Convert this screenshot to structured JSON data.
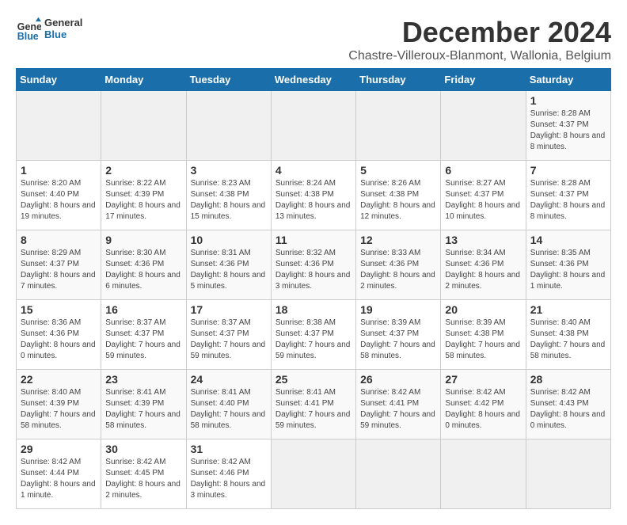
{
  "header": {
    "logo_general": "General",
    "logo_blue": "Blue",
    "title": "December 2024",
    "subtitle": "Chastre-Villeroux-Blanmont, Wallonia, Belgium"
  },
  "calendar": {
    "days_of_week": [
      "Sunday",
      "Monday",
      "Tuesday",
      "Wednesday",
      "Thursday",
      "Friday",
      "Saturday"
    ],
    "weeks": [
      [
        {
          "day": "",
          "empty": true
        },
        {
          "day": "",
          "empty": true
        },
        {
          "day": "",
          "empty": true
        },
        {
          "day": "",
          "empty": true
        },
        {
          "day": "",
          "empty": true
        },
        {
          "day": "",
          "empty": true
        },
        {
          "day": "1",
          "sunrise": "Sunrise: 8:28 AM",
          "sunset": "Sunset: 4:37 PM",
          "daylight": "Daylight: 8 hours and 8 minutes."
        }
      ],
      [
        {
          "day": "1",
          "sunrise": "Sunrise: 8:20 AM",
          "sunset": "Sunset: 4:40 PM",
          "daylight": "Daylight: 8 hours and 19 minutes."
        },
        {
          "day": "2",
          "sunrise": "Sunrise: 8:22 AM",
          "sunset": "Sunset: 4:39 PM",
          "daylight": "Daylight: 8 hours and 17 minutes."
        },
        {
          "day": "3",
          "sunrise": "Sunrise: 8:23 AM",
          "sunset": "Sunset: 4:38 PM",
          "daylight": "Daylight: 8 hours and 15 minutes."
        },
        {
          "day": "4",
          "sunrise": "Sunrise: 8:24 AM",
          "sunset": "Sunset: 4:38 PM",
          "daylight": "Daylight: 8 hours and 13 minutes."
        },
        {
          "day": "5",
          "sunrise": "Sunrise: 8:26 AM",
          "sunset": "Sunset: 4:38 PM",
          "daylight": "Daylight: 8 hours and 12 minutes."
        },
        {
          "day": "6",
          "sunrise": "Sunrise: 8:27 AM",
          "sunset": "Sunset: 4:37 PM",
          "daylight": "Daylight: 8 hours and 10 minutes."
        },
        {
          "day": "7",
          "sunrise": "Sunrise: 8:28 AM",
          "sunset": "Sunset: 4:37 PM",
          "daylight": "Daylight: 8 hours and 8 minutes."
        }
      ],
      [
        {
          "day": "8",
          "sunrise": "Sunrise: 8:29 AM",
          "sunset": "Sunset: 4:37 PM",
          "daylight": "Daylight: 8 hours and 7 minutes."
        },
        {
          "day": "9",
          "sunrise": "Sunrise: 8:30 AM",
          "sunset": "Sunset: 4:36 PM",
          "daylight": "Daylight: 8 hours and 6 minutes."
        },
        {
          "day": "10",
          "sunrise": "Sunrise: 8:31 AM",
          "sunset": "Sunset: 4:36 PM",
          "daylight": "Daylight: 8 hours and 5 minutes."
        },
        {
          "day": "11",
          "sunrise": "Sunrise: 8:32 AM",
          "sunset": "Sunset: 4:36 PM",
          "daylight": "Daylight: 8 hours and 3 minutes."
        },
        {
          "day": "12",
          "sunrise": "Sunrise: 8:33 AM",
          "sunset": "Sunset: 4:36 PM",
          "daylight": "Daylight: 8 hours and 2 minutes."
        },
        {
          "day": "13",
          "sunrise": "Sunrise: 8:34 AM",
          "sunset": "Sunset: 4:36 PM",
          "daylight": "Daylight: 8 hours and 2 minutes."
        },
        {
          "day": "14",
          "sunrise": "Sunrise: 8:35 AM",
          "sunset": "Sunset: 4:36 PM",
          "daylight": "Daylight: 8 hours and 1 minute."
        }
      ],
      [
        {
          "day": "15",
          "sunrise": "Sunrise: 8:36 AM",
          "sunset": "Sunset: 4:36 PM",
          "daylight": "Daylight: 8 hours and 0 minutes."
        },
        {
          "day": "16",
          "sunrise": "Sunrise: 8:37 AM",
          "sunset": "Sunset: 4:37 PM",
          "daylight": "Daylight: 7 hours and 59 minutes."
        },
        {
          "day": "17",
          "sunrise": "Sunrise: 8:37 AM",
          "sunset": "Sunset: 4:37 PM",
          "daylight": "Daylight: 7 hours and 59 minutes."
        },
        {
          "day": "18",
          "sunrise": "Sunrise: 8:38 AM",
          "sunset": "Sunset: 4:37 PM",
          "daylight": "Daylight: 7 hours and 59 minutes."
        },
        {
          "day": "19",
          "sunrise": "Sunrise: 8:39 AM",
          "sunset": "Sunset: 4:37 PM",
          "daylight": "Daylight: 7 hours and 58 minutes."
        },
        {
          "day": "20",
          "sunrise": "Sunrise: 8:39 AM",
          "sunset": "Sunset: 4:38 PM",
          "daylight": "Daylight: 7 hours and 58 minutes."
        },
        {
          "day": "21",
          "sunrise": "Sunrise: 8:40 AM",
          "sunset": "Sunset: 4:38 PM",
          "daylight": "Daylight: 7 hours and 58 minutes."
        }
      ],
      [
        {
          "day": "22",
          "sunrise": "Sunrise: 8:40 AM",
          "sunset": "Sunset: 4:39 PM",
          "daylight": "Daylight: 7 hours and 58 minutes."
        },
        {
          "day": "23",
          "sunrise": "Sunrise: 8:41 AM",
          "sunset": "Sunset: 4:39 PM",
          "daylight": "Daylight: 7 hours and 58 minutes."
        },
        {
          "day": "24",
          "sunrise": "Sunrise: 8:41 AM",
          "sunset": "Sunset: 4:40 PM",
          "daylight": "Daylight: 7 hours and 58 minutes."
        },
        {
          "day": "25",
          "sunrise": "Sunrise: 8:41 AM",
          "sunset": "Sunset: 4:41 PM",
          "daylight": "Daylight: 7 hours and 59 minutes."
        },
        {
          "day": "26",
          "sunrise": "Sunrise: 8:42 AM",
          "sunset": "Sunset: 4:41 PM",
          "daylight": "Daylight: 7 hours and 59 minutes."
        },
        {
          "day": "27",
          "sunrise": "Sunrise: 8:42 AM",
          "sunset": "Sunset: 4:42 PM",
          "daylight": "Daylight: 8 hours and 0 minutes."
        },
        {
          "day": "28",
          "sunrise": "Sunrise: 8:42 AM",
          "sunset": "Sunset: 4:43 PM",
          "daylight": "Daylight: 8 hours and 0 minutes."
        }
      ],
      [
        {
          "day": "29",
          "sunrise": "Sunrise: 8:42 AM",
          "sunset": "Sunset: 4:44 PM",
          "daylight": "Daylight: 8 hours and 1 minute."
        },
        {
          "day": "30",
          "sunrise": "Sunrise: 8:42 AM",
          "sunset": "Sunset: 4:45 PM",
          "daylight": "Daylight: 8 hours and 2 minutes."
        },
        {
          "day": "31",
          "sunrise": "Sunrise: 8:42 AM",
          "sunset": "Sunset: 4:46 PM",
          "daylight": "Daylight: 8 hours and 3 minutes."
        },
        {
          "day": "",
          "empty": true
        },
        {
          "day": "",
          "empty": true
        },
        {
          "day": "",
          "empty": true
        },
        {
          "day": "",
          "empty": true
        }
      ]
    ]
  }
}
